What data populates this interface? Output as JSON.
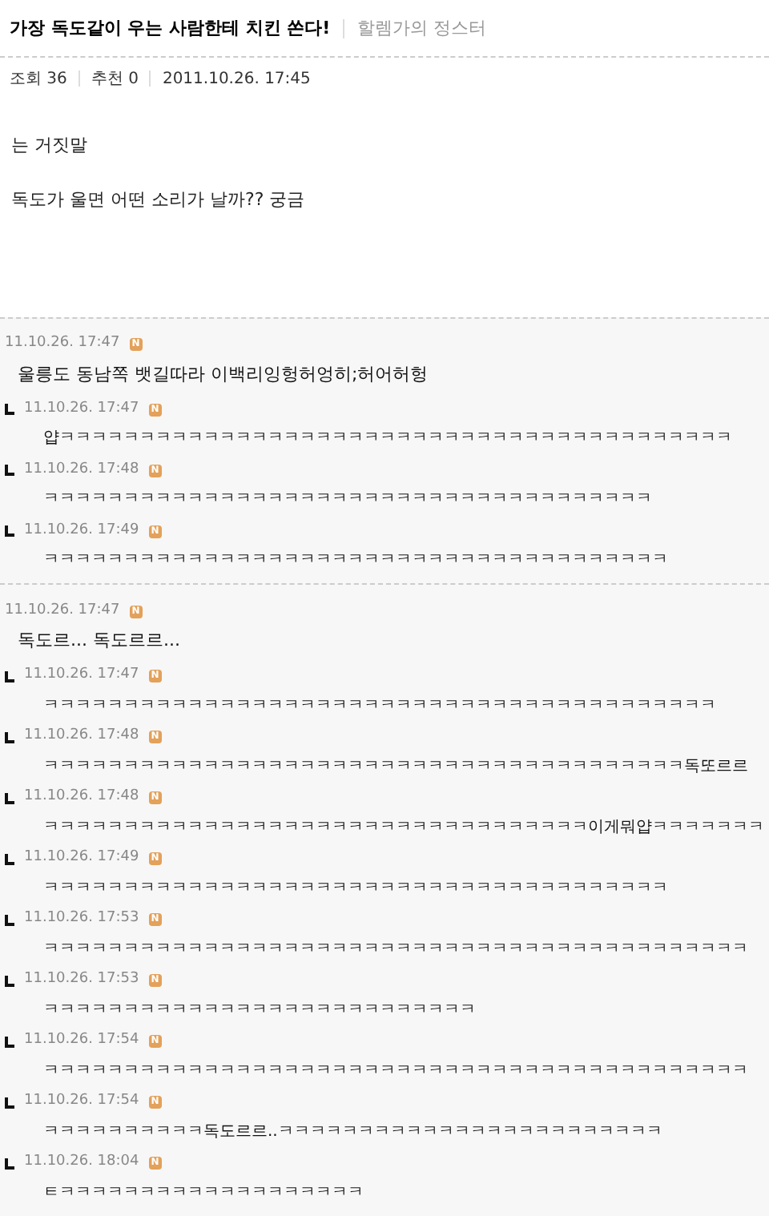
{
  "post": {
    "title": "가장 독도같이 우는 사람한테 치킨 쏜다!",
    "author": "할렘가의 정스터",
    "meta": [
      "조회 36",
      "추천 0",
      "2011.10.26. 17:45"
    ],
    "body": [
      "는 거짓말",
      "독도가 울면 어떤 소리가 날까?? 궁금"
    ]
  },
  "threads": [
    {
      "time": "11.10.26. 17:47",
      "badge": "N",
      "text": "울릉도 동남쪽 뱃길따라 이백리잉헝허엉히;허어허헝",
      "replies": [
        {
          "time": "11.10.26. 17:47",
          "badge": "N",
          "text": "얍ㅋㅋㅋㅋㅋㅋㅋㅋㅋㅋㅋㅋㅋㅋㅋㅋㅋㅋㅋㅋㅋㅋㅋㅋㅋㅋㅋㅋㅋㅋㅋㅋㅋㅋㅋㅋㅋㅋㅋㅋㅋㅋ"
        },
        {
          "time": "11.10.26. 17:48",
          "badge": "N",
          "text": "ㅋㅋㅋㅋㅋㅋㅋㅋㅋㅋㅋㅋㅋㅋㅋㅋㅋㅋㅋㅋㅋㅋㅋㅋㅋㅋㅋㅋㅋㅋㅋㅋㅋㅋㅋㅋㅋㅋ"
        },
        {
          "time": "11.10.26. 17:49",
          "badge": "N",
          "text": "ㅋㅋㅋㅋㅋㅋㅋㅋㅋㅋㅋㅋㅋㅋㅋㅋㅋㅋㅋㅋㅋㅋㅋㅋㅋㅋㅋㅋㅋㅋㅋㅋㅋㅋㅋㅋㅋㅋㅋ"
        }
      ]
    },
    {
      "time": "11.10.26. 17:47",
      "badge": "N",
      "text": "독도르... 독도르르...",
      "replies": [
        {
          "time": "11.10.26. 17:47",
          "badge": "N",
          "text": "ㅋㅋㅋㅋㅋㅋㅋㅋㅋㅋㅋㅋㅋㅋㅋㅋㅋㅋㅋㅋㅋㅋㅋㅋㅋㅋㅋㅋㅋㅋㅋㅋㅋㅋㅋㅋㅋㅋㅋㅋㅋㅋ"
        },
        {
          "time": "11.10.26. 17:48",
          "badge": "N",
          "text": "ㅋㅋㅋㅋㅋㅋㅋㅋㅋㅋㅋㅋㅋㅋㅋㅋㅋㅋㅋㅋㅋㅋㅋㅋㅋㅋㅋㅋㅋㅋㅋㅋㅋㅋㅋㅋㅋㅋㅋㅋ독또르르"
        },
        {
          "time": "11.10.26. 17:48",
          "badge": "N",
          "text": "ㅋㅋㅋㅋㅋㅋㅋㅋㅋㅋㅋㅋㅋㅋㅋㅋㅋㅋㅋㅋㅋㅋㅋㅋㅋㅋㅋㅋㅋㅋㅋㅋㅋㅋ이게뭐얍ㅋㅋㅋㅋㅋㅋㅋ"
        },
        {
          "time": "11.10.26. 17:49",
          "badge": "N",
          "text": "ㅋㅋㅋㅋㅋㅋㅋㅋㅋㅋㅋㅋㅋㅋㅋㅋㅋㅋㅋㅋㅋㅋㅋㅋㅋㅋㅋㅋㅋㅋㅋㅋㅋㅋㅋㅋㅋㅋㅋ"
        },
        {
          "time": "11.10.26. 17:53",
          "badge": "N",
          "text": "ㅋㅋㅋㅋㅋㅋㅋㅋㅋㅋㅋㅋㅋㅋㅋㅋㅋㅋㅋㅋㅋㅋㅋㅋㅋㅋㅋㅋㅋㅋㅋㅋㅋㅋㅋㅋㅋㅋㅋㅋㅋㅋㅋㅋ"
        },
        {
          "time": "11.10.26. 17:53",
          "badge": "N",
          "text": "ㅋㅋㅋㅋㅋㅋㅋㅋㅋㅋㅋㅋㅋㅋㅋㅋㅋㅋㅋㅋㅋㅋㅋㅋㅋㅋㅋ"
        },
        {
          "time": "11.10.26. 17:54",
          "badge": "N",
          "text": "ㅋㅋㅋㅋㅋㅋㅋㅋㅋㅋㅋㅋㅋㅋㅋㅋㅋㅋㅋㅋㅋㅋㅋㅋㅋㅋㅋㅋㅋㅋㅋㅋㅋㅋㅋㅋㅋㅋㅋㅋㅋㅋㅋㅋ"
        },
        {
          "time": "11.10.26. 17:54",
          "badge": "N",
          "text": "ㅋㅋㅋㅋㅋㅋㅋㅋㅋㅋ독도르르..ㅋㅋㅋㅋㅋㅋㅋㅋㅋㅋㅋㅋㅋㅋㅋㅋㅋㅋㅋㅋㅋㅋㅋㅋ"
        },
        {
          "time": "11.10.26. 18:04",
          "badge": "N",
          "text": "ㅌㅋㅋㅋㅋㅋㅋㅋㅋㅋㅋㅋㅋㅋㅋㅋㅋㅋㅋㅋ"
        }
      ]
    }
  ]
}
